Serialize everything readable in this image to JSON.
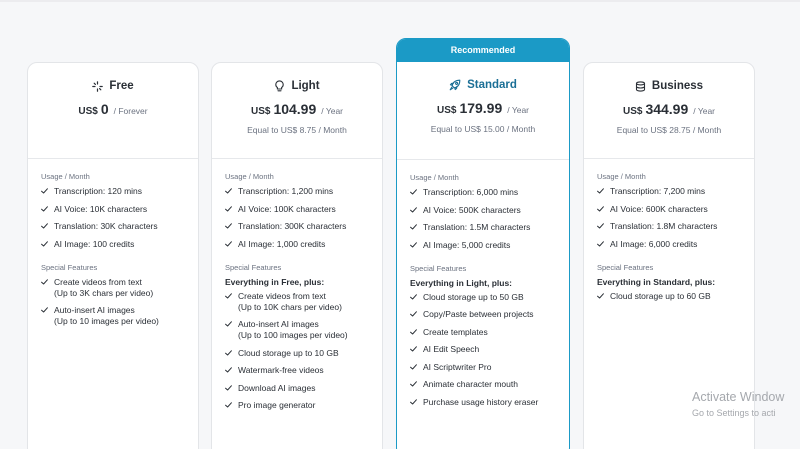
{
  "plans": {
    "free": {
      "name": "Free",
      "icon": "sparkle-icon",
      "currency": "US$",
      "price": "0",
      "period": "/ Forever",
      "usage_label": "Usage / Month",
      "usage": [
        "Transcription: 120 mins",
        "AI Voice: 10K characters",
        "Translation: 30K characters",
        "AI Image: 100 credits"
      ],
      "special_label": "Special Features",
      "special": [
        [
          "Create videos from text",
          "(Up to 3K chars per video)"
        ],
        [
          "Auto-insert AI images",
          "(Up to 10 images per video)"
        ]
      ]
    },
    "light": {
      "name": "Light",
      "icon": "lightbulb-icon",
      "currency": "US$",
      "price": "104.99",
      "period": "/ Year",
      "equal": "Equal to US$ 8.75 / Month",
      "usage_label": "Usage / Month",
      "usage": [
        "Transcription: 1,200 mins",
        "AI Voice: 100K characters",
        "Translation: 300K characters",
        "AI Image: 1,000 credits"
      ],
      "special_label": "Special Features",
      "plus": "Everything in Free, plus:",
      "special": [
        [
          "Create videos from text",
          "(Up to 10K chars per video)"
        ],
        [
          "Auto-insert AI images",
          "(Up to 100 images per video)"
        ],
        [
          "Cloud storage up to 10 GB"
        ],
        [
          "Watermark-free videos"
        ],
        [
          "Download AI images"
        ],
        [
          "Pro image generator"
        ]
      ]
    },
    "standard": {
      "badge": "Recommended",
      "name": "Standard",
      "icon": "rocket-icon",
      "currency": "US$",
      "price": "179.99",
      "period": "/ Year",
      "equal": "Equal to US$ 15.00 / Month",
      "usage_label": "Usage / Month",
      "usage": [
        "Transcription: 6,000 mins",
        "AI Voice: 500K characters",
        "Translation: 1.5M characters",
        "AI Image: 5,000 credits"
      ],
      "special_label": "Special Features",
      "plus": "Everything in Light, plus:",
      "special": [
        [
          "Cloud storage up to 50 GB"
        ],
        [
          "Copy/Paste between projects"
        ],
        [
          "Create templates"
        ],
        [
          "AI Edit Speech"
        ],
        [
          "AI Scriptwriter Pro"
        ],
        [
          "Animate character mouth"
        ],
        [
          "Purchase usage history eraser"
        ]
      ]
    },
    "business": {
      "name": "Business",
      "icon": "database-icon",
      "currency": "US$",
      "price": "344.99",
      "period": "/ Year",
      "equal": "Equal to US$ 28.75 / Month",
      "usage_label": "Usage / Month",
      "usage": [
        "Transcription: 7,200 mins",
        "AI Voice: 600K characters",
        "Translation: 1.8M characters",
        "AI Image: 6,000 credits"
      ],
      "special_label": "Special Features",
      "plus": "Everything in Standard, plus:",
      "special": [
        [
          "Cloud storage up to 60 GB"
        ]
      ]
    }
  },
  "watermark": {
    "line1": "Activate Window",
    "line2": "Go to Settings to acti"
  },
  "colors": {
    "accent": "#1b9ac6",
    "text": "#2a2f36",
    "muted": "#6b7280",
    "border": "#e3e5e8"
  }
}
